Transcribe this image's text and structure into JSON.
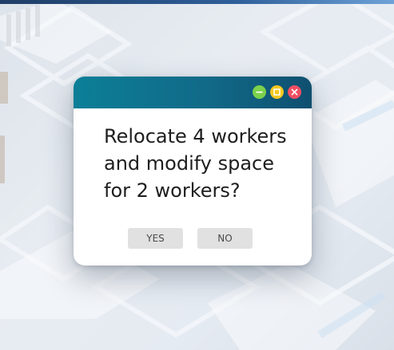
{
  "dialog": {
    "message": "Relocate 4 workers\nand modify space\nfor 2 workers?",
    "buttons": {
      "yes": "YES",
      "no": "NO"
    },
    "window_controls": {
      "minimize_icon": "minus-icon",
      "maximize_icon": "square-icon",
      "close_icon": "x-icon"
    }
  },
  "colors": {
    "titlebar_start": "#0c7f97",
    "titlebar_end": "#0f4f70",
    "minimize": "#7bd14b",
    "maximize": "#f6c820",
    "close": "#ef4f63",
    "button_bg": "#e1e1e1"
  }
}
